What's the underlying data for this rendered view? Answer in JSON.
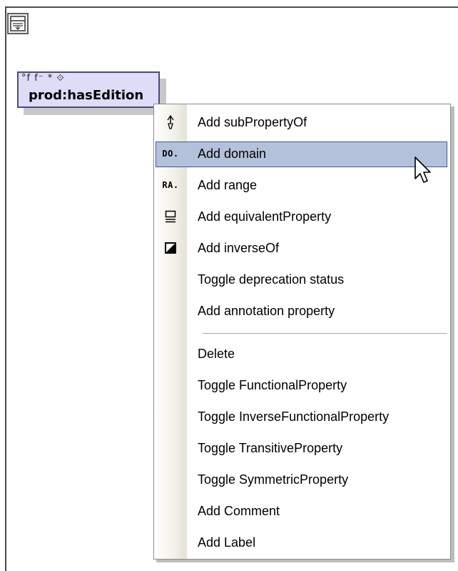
{
  "property": {
    "flags": "°f  f⁻ * ⟐",
    "name": "prod:hasEdition"
  },
  "menu": {
    "items": [
      {
        "label": "Add subPropertyOf",
        "icon": "subproperty-icon"
      },
      {
        "label": "Add domain",
        "icon": "domain-icon",
        "icon_text": "DO.",
        "highlighted": true
      },
      {
        "label": "Add range",
        "icon": "range-icon",
        "icon_text": "RA."
      },
      {
        "label": "Add equivalentProperty",
        "icon": "equivalent-property-icon"
      },
      {
        "label": "Add inverseOf",
        "icon": "inverse-of-icon"
      },
      {
        "label": "Toggle deprecation status"
      },
      {
        "label": "Add annotation property"
      },
      {
        "label": "Delete"
      },
      {
        "label": "Toggle FunctionalProperty"
      },
      {
        "label": "Toggle InverseFunctionalProperty"
      },
      {
        "label": "Toggle TransitiveProperty"
      },
      {
        "label": "Toggle SymmetricProperty"
      },
      {
        "label": "Add Comment"
      },
      {
        "label": "Add Label"
      }
    ]
  },
  "colors": {
    "highlight": "#b4c1db",
    "highlight_border": "#3a5a9a",
    "node_fill": "#dedcf7"
  }
}
